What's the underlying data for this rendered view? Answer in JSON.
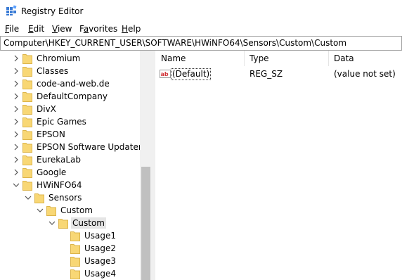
{
  "window": {
    "title": "Registry Editor",
    "icon": "registry-editor-icon"
  },
  "menu": [
    {
      "pre": "",
      "ul": "F",
      "post": "ile"
    },
    {
      "pre": "",
      "ul": "E",
      "post": "dit"
    },
    {
      "pre": "",
      "ul": "V",
      "post": "iew"
    },
    {
      "pre": "F",
      "ul": "a",
      "post": "vorites"
    },
    {
      "pre": "",
      "ul": "H",
      "post": "elp"
    }
  ],
  "address": {
    "path": "Computer\\HKEY_CURRENT_USER\\SOFTWARE\\HWiNFO64\\Sensors\\Custom\\Custom"
  },
  "tree": {
    "nodes": [
      {
        "label": "Chromium",
        "expanded": false
      },
      {
        "label": "Classes",
        "expanded": false
      },
      {
        "label": "code-and-web.de",
        "expanded": false
      },
      {
        "label": "DefaultCompany",
        "expanded": false
      },
      {
        "label": "DivX",
        "expanded": false
      },
      {
        "label": "Epic Games",
        "expanded": false
      },
      {
        "label": "EPSON",
        "expanded": false
      },
      {
        "label": "EPSON Software Updater",
        "expanded": false
      },
      {
        "label": "EurekaLab",
        "expanded": false
      },
      {
        "label": "Google",
        "expanded": false
      },
      {
        "label": "HWiNFO64",
        "expanded": true
      },
      {
        "label": "Sensors",
        "expanded": true
      },
      {
        "label": "Custom",
        "expanded": true
      },
      {
        "label": "Custom",
        "expanded": true,
        "selected": true
      },
      {
        "label": "Usage1",
        "leaf": true
      },
      {
        "label": "Usage2",
        "leaf": true
      },
      {
        "label": "Usage3",
        "leaf": true
      },
      {
        "label": "Usage4",
        "leaf": true
      }
    ]
  },
  "list": {
    "columns": {
      "name": "Name",
      "type": "Type",
      "data": "Data"
    },
    "rows": [
      {
        "name": "(Default)",
        "type": "REG_SZ",
        "data": "(value not set)",
        "icon": "string-value-icon"
      }
    ]
  },
  "colors": {
    "folder": "#f8d775",
    "folder_edge": "#dcb44a",
    "selected_bg": "#e5e5e5",
    "value_icon": "#d13438"
  }
}
